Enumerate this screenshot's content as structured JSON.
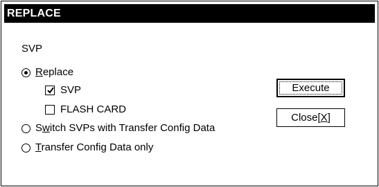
{
  "dialog": {
    "title": "REPLACE",
    "group_label": "SVP"
  },
  "options": {
    "replace": {
      "accel": "R",
      "rest": "eplace",
      "checked": true
    },
    "svp_checkbox": {
      "label": "SVP",
      "checked": true
    },
    "flash_card_checkbox": {
      "label": "FLASH CARD",
      "checked": false
    },
    "switch_svps": {
      "prefix": "S",
      "accel": "w",
      "rest": "itch SVPs with Transfer Config Data",
      "checked": false
    },
    "transfer_only": {
      "accel": "T",
      "rest": "ransfer Config Data only",
      "checked": false
    }
  },
  "buttons": {
    "execute_label": "Execute",
    "close_label": "Close",
    "close_accel": "X",
    "close_bracket_open": "[",
    "close_bracket_close": "]"
  }
}
